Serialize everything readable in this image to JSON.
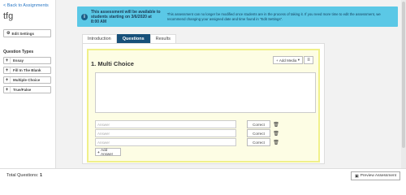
{
  "sidebar": {
    "back_link": "< Back to Assignments",
    "quiz_title": "tfg",
    "edit_settings_label": "Edit Settings",
    "question_types_label": "Question Types",
    "question_types": [
      {
        "label": "Essay"
      },
      {
        "label": "Fill In The Blank"
      },
      {
        "label": "Multiple Choice"
      },
      {
        "label": "True/False"
      }
    ]
  },
  "alert": {
    "bold_text": "This assessment will be available to students starting on 3/6/2020 at 8:00 AM",
    "normal_text": "This assessment can no longer be modified once students are in the process of taking it. If you need more time to edit the assessment, we recommend changing your assigned date and time found in \"Edit Settings\"."
  },
  "tabs": [
    {
      "label": "Introduction",
      "active": false
    },
    {
      "label": "Questions",
      "active": true
    },
    {
      "label": "Results",
      "active": false
    }
  ],
  "question": {
    "title": "1. Multi Choice",
    "add_media_label": "Add Media",
    "answers": [
      {
        "placeholder": "Answer",
        "correct_label": "Correct"
      },
      {
        "placeholder": "Answer",
        "correct_label": "Correct"
      },
      {
        "placeholder": "Answer",
        "correct_label": "Correct"
      }
    ],
    "add_answer_label": "Add Answer"
  },
  "footer": {
    "total_label": "Total Questions:",
    "total_value": "1",
    "preview_label": "Preview Assessment"
  },
  "icons": {
    "info": "info-icon",
    "gear": "gear-icon",
    "trash": "trash-icon",
    "plus": "plus-icon",
    "preview": "preview-icon"
  },
  "colors": {
    "alert_bg": "#5bc8e6",
    "active_tab": "#17507a",
    "highlight_bg": "#fdfde4",
    "link": "#2a78c5"
  }
}
